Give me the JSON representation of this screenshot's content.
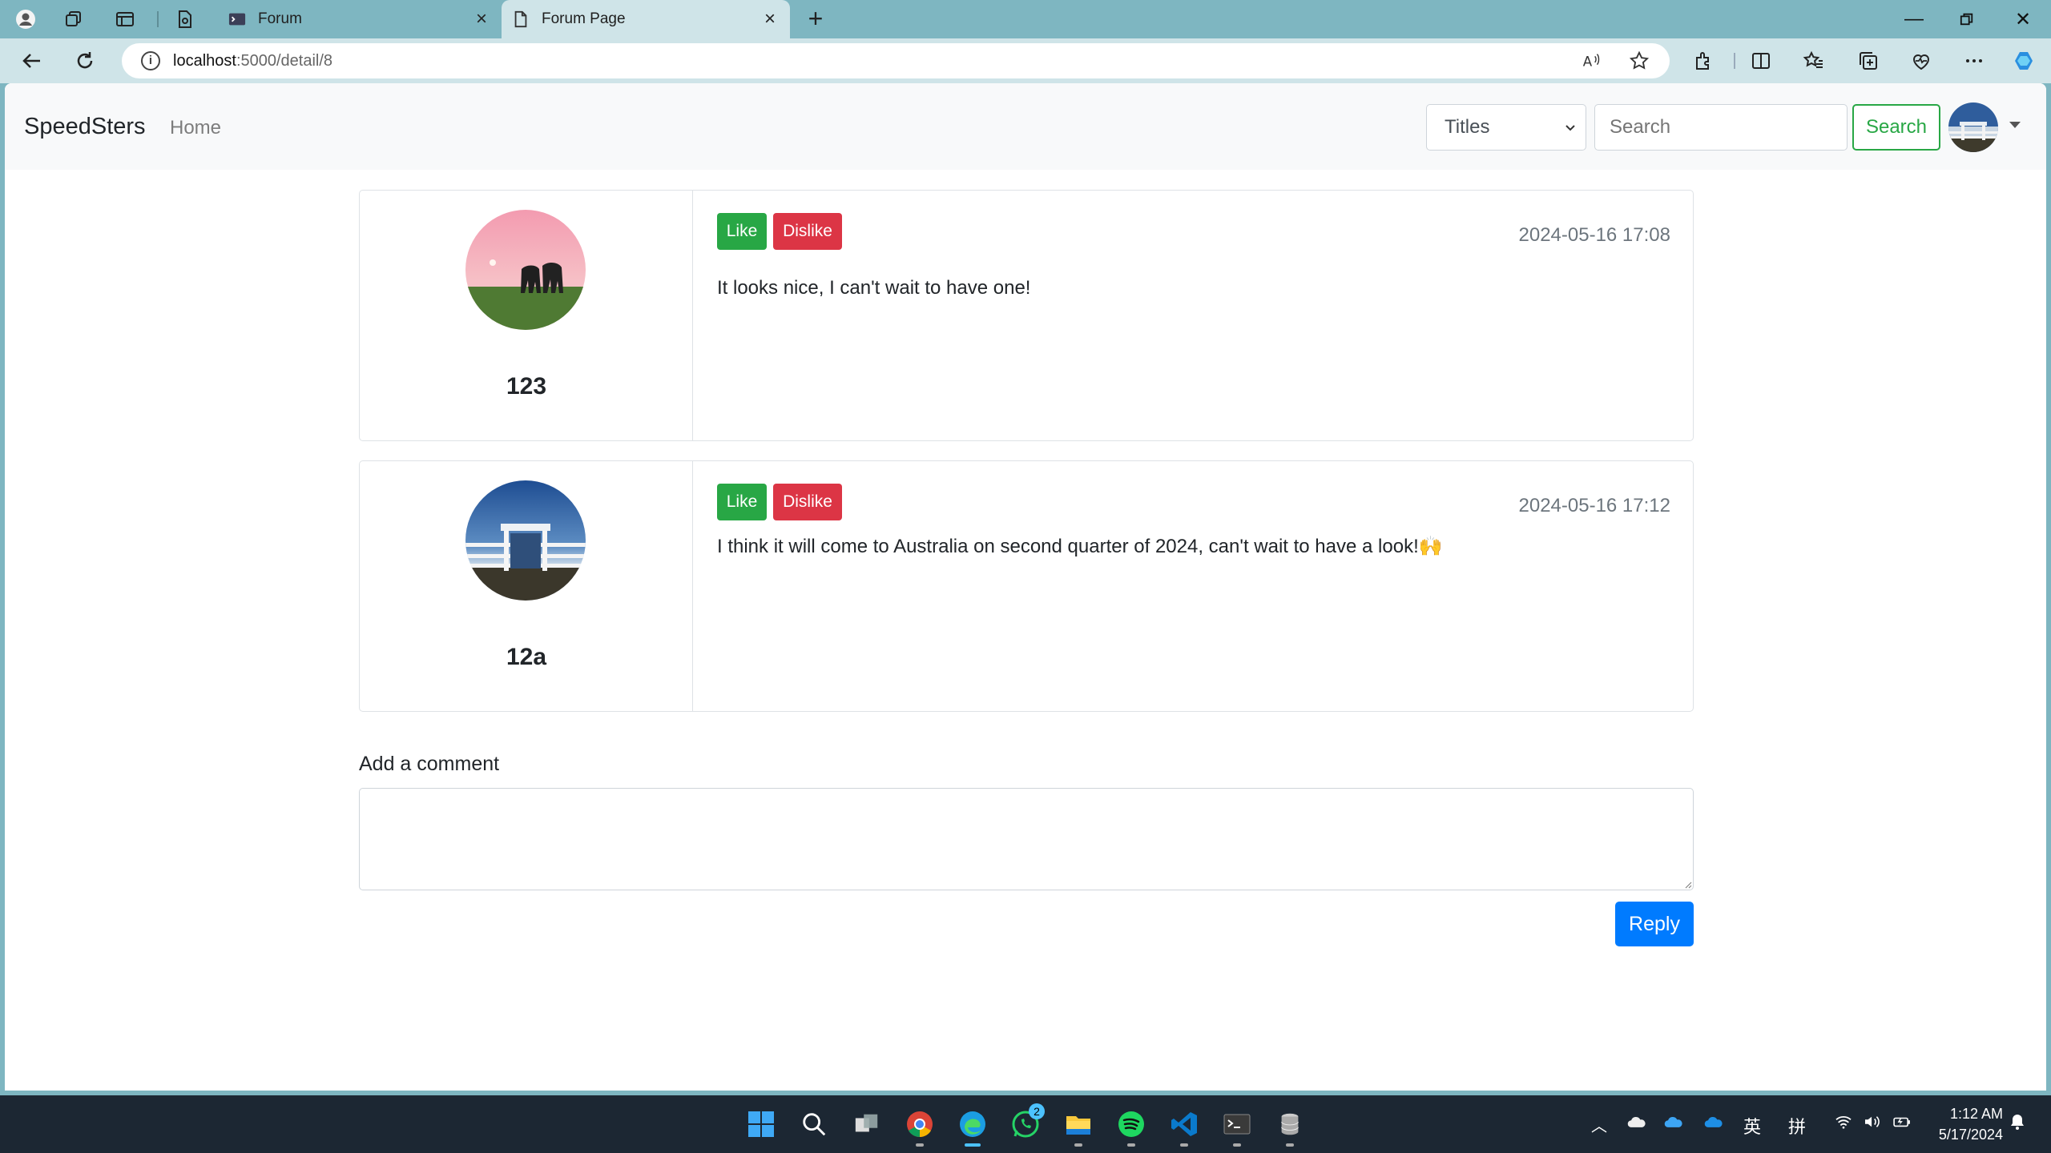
{
  "browser": {
    "tabs": [
      {
        "title": "Forum"
      },
      {
        "title": "Forum Page"
      }
    ],
    "address": {
      "host": "localhost",
      "rest": ":5000/detail/8"
    }
  },
  "navbar": {
    "brand": "SpeedSters",
    "home": "Home",
    "filter_selected": "Titles",
    "search_placeholder": "Search",
    "search_button": "Search"
  },
  "posts": [
    {
      "username": "123",
      "like": "Like",
      "dislike": "Dislike",
      "date": "2024-05-16 17:08",
      "text": "It looks nice, I can't wait to have one!"
    },
    {
      "username": "12a",
      "like": "Like",
      "dislike": "Dislike",
      "date": "2024-05-16 17:12",
      "text": "I think it will come to Australia on second quarter of 2024, can't wait to have a look!🙌"
    }
  ],
  "comment": {
    "label": "Add a comment",
    "value": "",
    "reply_button": "Reply"
  },
  "taskbar": {
    "whatsapp_badge": "2",
    "lang1": "英",
    "lang2": "拼",
    "time": "1:12 AM",
    "date": "5/17/2024"
  },
  "colors": {
    "like": "#28a745",
    "dislike": "#dc3545",
    "reply": "#007bff",
    "chrome": "#7eb6c1"
  }
}
